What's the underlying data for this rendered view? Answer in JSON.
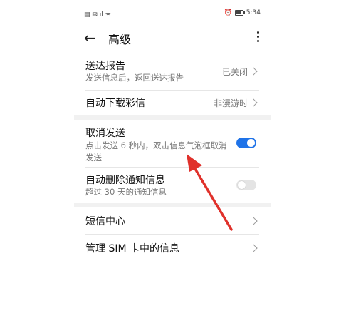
{
  "status_bar": {
    "left_icons": "▤ ✉ ıl ᯤ",
    "alarm": "⏰",
    "time": "5:34"
  },
  "header": {
    "back_icon": "arrow-left-icon",
    "title": "高级",
    "more_icon": "more-vertical-icon"
  },
  "settings": [
    {
      "label": "送达报告",
      "subtitle": "发送信息后，返回送达报告",
      "value": "已关闭"
    },
    {
      "label": "自动下载彩信",
      "value": "非漫游时"
    },
    {
      "label": "取消发送",
      "subtitle": "点击发送 6 秒内，双击信息气泡框取消发送",
      "toggle": true
    },
    {
      "label": "自动删除通知信息",
      "subtitle": "超过 30 天的通知信息",
      "toggle": false
    },
    {
      "label": "短信中心"
    },
    {
      "label": "管理 SIM 卡中的信息"
    }
  ],
  "colors": {
    "accent": "#1f73e8",
    "annotation_arrow": "#e0312b"
  }
}
